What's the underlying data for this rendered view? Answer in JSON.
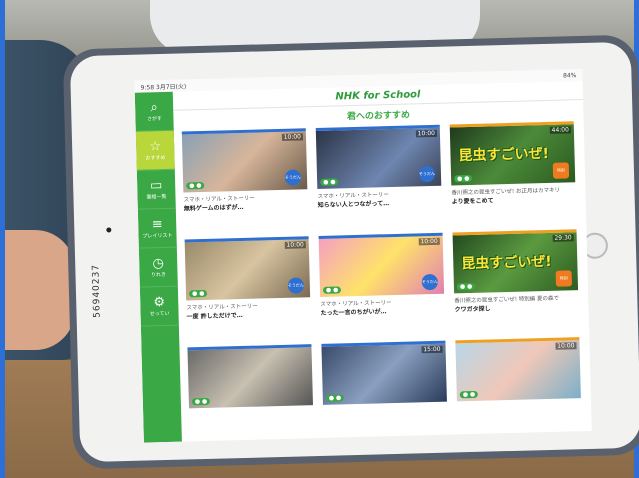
{
  "screen": {
    "status_time": "9:58 3月7日(火)",
    "status_battery": "84%",
    "logo": "NHK for School",
    "section_title": "君へのおすすめ"
  },
  "sidebar": {
    "items": [
      {
        "icon": "search-icon",
        "glyph": "⌕",
        "label": "さがす"
      },
      {
        "icon": "star-icon",
        "glyph": "☆",
        "label": "おすすめ"
      },
      {
        "icon": "monitor-icon",
        "glyph": "▭",
        "label": "番組一覧"
      },
      {
        "icon": "playlist-icon",
        "glyph": "≡",
        "label": "プレイリスト"
      },
      {
        "icon": "clock-icon",
        "glyph": "◷",
        "label": "りれき"
      },
      {
        "icon": "gear-icon",
        "glyph": "⚙",
        "label": "せってい"
      }
    ]
  },
  "cards": [
    {
      "duration": "10:00",
      "badge": "そうだん",
      "line1": "スマホ・リアル・ストーリー",
      "line2": "無料ゲームのはずが…"
    },
    {
      "duration": "10:00",
      "badge": "そうだん",
      "line1": "スマホ・リアル・ストーリー",
      "line2": "知らない人とつながって…"
    },
    {
      "duration": "44:00",
      "big": "昆虫すごいぜ!",
      "badge": "特別",
      "line1": "香川照之の昆虫すごいぜ!  お正月はカマキリ",
      "line2": "より愛をこめて"
    },
    {
      "duration": "10:00",
      "badge": "そうだん",
      "line1": "スマホ・リアル・ストーリー",
      "line2": "一度 許しただけで…"
    },
    {
      "duration": "10:00",
      "badge": "そうだん",
      "line1": "スマホ・リアル・ストーリー",
      "line2": "たった一言のちがいが…"
    },
    {
      "duration": "29:30",
      "big": "昆虫すごいぜ!",
      "badge": "特別",
      "line1": "香川照之の昆虫すごいぜ!  特別編  夏の森で",
      "line2": "クワガタ探し"
    },
    {
      "duration": "",
      "badge": "",
      "line1": "",
      "line2": ""
    },
    {
      "duration": "15:00",
      "badge": "",
      "line1": "",
      "line2": ""
    },
    {
      "duration": "10:00",
      "badge": "",
      "line1": "",
      "line2": ""
    }
  ],
  "device": {
    "serial": "56940237"
  }
}
